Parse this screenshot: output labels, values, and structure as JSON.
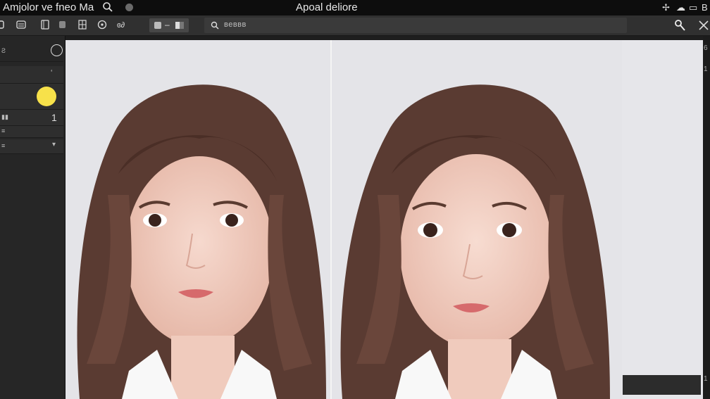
{
  "app": {
    "title": "Amjolor ve fneo Ma",
    "document_title": "Apoal deliore"
  },
  "toolbar": {
    "search_text": "веввв"
  },
  "left_panel": {
    "row1_label": "Ƨ",
    "row2_value": "1",
    "row3_label": "≡",
    "row4_label": "≡",
    "row4_chevron": "▾",
    "row1_chevron": "ʻ",
    "color_swatch": "#f7e14a"
  },
  "canvas": {
    "panes": [
      "before",
      "after"
    ]
  },
  "colors": {
    "titlebar": "#0d0d0d",
    "toolbar": "#303030",
    "panel": "#262626",
    "accent": "#f7e14a"
  },
  "scrollbar": {
    "top_mark": "6",
    "mark2": "1",
    "bottom_mark": "1"
  }
}
